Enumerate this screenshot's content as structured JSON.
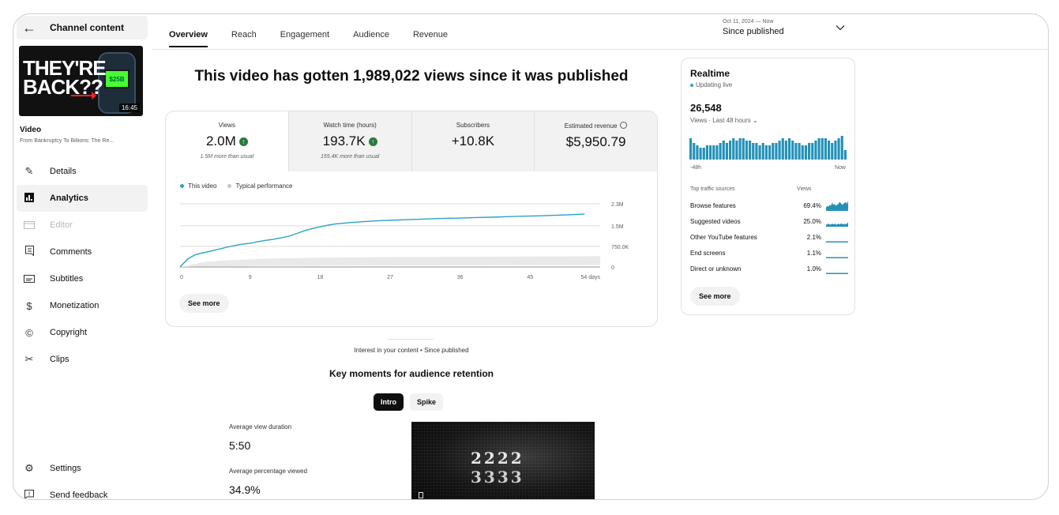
{
  "sidebar": {
    "back_icon": "arrow-left-icon",
    "header": "Channel content",
    "thumbnail": {
      "headline": "THEY'RE BACK??",
      "screen_text": "$25B",
      "duration": "16:45"
    },
    "video_label": "Video",
    "video_title": "From Bankruptcy To Billions: The Re...",
    "items": [
      {
        "label": "Details",
        "icon": "pencil-icon"
      },
      {
        "label": "Analytics",
        "icon": "analytics-icon",
        "active": true
      },
      {
        "label": "Editor",
        "icon": "editor-icon",
        "disabled": true
      },
      {
        "label": "Comments",
        "icon": "comments-icon"
      },
      {
        "label": "Subtitles",
        "icon": "subtitles-icon"
      },
      {
        "label": "Monetization",
        "icon": "dollar-icon"
      },
      {
        "label": "Copyright",
        "icon": "copyright-icon"
      },
      {
        "label": "Clips",
        "icon": "scissors-icon"
      }
    ],
    "bottom": [
      {
        "label": "Settings",
        "icon": "gear-icon"
      },
      {
        "label": "Send feedback",
        "icon": "feedback-icon"
      }
    ]
  },
  "tabs": [
    "Overview",
    "Reach",
    "Engagement",
    "Audience",
    "Revenue"
  ],
  "date_range": {
    "range": "Oct 11, 2024 — Now",
    "label": "Since published"
  },
  "headline": "This video has gotten 1,989,022 views since it was published",
  "metrics": [
    {
      "label": "Views",
      "value": "2.0M",
      "note": "1.5M more than usual",
      "trend_up": true
    },
    {
      "label": "Watch time (hours)",
      "value": "193.7K",
      "note": "155.4K more than usual",
      "trend_up": true
    },
    {
      "label": "Subscribers",
      "value": "+10.8K",
      "note": ""
    },
    {
      "label": "Estimated revenue",
      "value": "$5,950.79",
      "note": ""
    }
  ],
  "chart_data": {
    "type": "line",
    "legend": [
      "This video",
      "Typical performance"
    ],
    "x_ticks": [
      "0",
      "9",
      "18",
      "27",
      "36",
      "45",
      "54 days"
    ],
    "y_ticks": [
      "0",
      "750.0K",
      "1.5M",
      "2.3M"
    ],
    "xlim": [
      0,
      54
    ],
    "ylim": [
      0,
      2300000
    ],
    "colors": {
      "this_video": "#2ba3c4",
      "typical": "#e9e9e9",
      "grid": "#dcdcdc"
    },
    "series": [
      {
        "name": "This video",
        "x": [
          0,
          1,
          2,
          3,
          4,
          5,
          6,
          7,
          8,
          9,
          10,
          11,
          12,
          13,
          14,
          15,
          16,
          17,
          18,
          19,
          20,
          22,
          24,
          26,
          28,
          30,
          32,
          34,
          36,
          38,
          40,
          42,
          44,
          46,
          48,
          50,
          52
        ],
        "y": [
          0,
          300000,
          450000,
          520000,
          580000,
          650000,
          720000,
          780000,
          830000,
          860000,
          920000,
          970000,
          1010000,
          1060000,
          1120000,
          1220000,
          1320000,
          1400000,
          1460000,
          1520000,
          1570000,
          1620000,
          1660000,
          1690000,
          1710000,
          1730000,
          1750000,
          1770000,
          1780000,
          1800000,
          1810000,
          1830000,
          1850000,
          1860000,
          1880000,
          1900000,
          1930000
        ]
      },
      {
        "name": "Typical performance",
        "band_x": [
          0,
          3,
          6,
          9,
          12,
          18,
          27,
          36,
          45,
          54
        ],
        "band_low": [
          0,
          20000,
          30000,
          40000,
          45000,
          50000,
          55000,
          60000,
          65000,
          70000
        ],
        "band_high": [
          0,
          180000,
          240000,
          280000,
          310000,
          340000,
          360000,
          370000,
          380000,
          390000
        ]
      }
    ]
  },
  "see_more": "See more",
  "realtime": {
    "title": "Realtime",
    "status": "Updating live",
    "count": "26,548",
    "count_label": "Views · Last 48 hours",
    "bar_values": [
      9,
      7,
      6,
      5,
      5,
      6,
      6,
      6,
      6,
      7,
      8,
      7,
      8,
      9,
      8,
      9,
      9,
      8,
      8,
      7,
      7,
      6,
      7,
      6,
      6,
      7,
      7,
      8,
      9,
      8,
      9,
      8,
      7,
      7,
      6,
      6,
      7,
      7,
      8,
      9,
      9,
      9,
      8,
      7,
      8,
      9,
      10,
      4
    ],
    "axis_start": "-48h",
    "axis_end": "Now",
    "table_header": [
      "Top traffic sources",
      "Views"
    ],
    "sources": [
      {
        "name": "Browse features",
        "pct": "69.4%",
        "spark": [
          3,
          5,
          4,
          6,
          5,
          8,
          6,
          7,
          5,
          6,
          7,
          9,
          8,
          6,
          7,
          8,
          9,
          7,
          10
        ]
      },
      {
        "name": "Suggested videos",
        "pct": "25.0%",
        "spark": [
          2,
          2,
          3,
          2,
          2,
          3,
          2,
          3,
          2,
          2,
          3,
          2,
          3,
          3,
          2,
          3,
          2,
          3,
          4
        ]
      },
      {
        "name": "Other YouTube features",
        "pct": "2.1%",
        "spark": [
          1,
          1,
          1,
          1,
          1,
          1,
          1,
          1,
          1,
          1,
          1,
          1,
          1,
          1,
          1,
          1,
          1,
          1,
          1
        ]
      },
      {
        "name": "End screens",
        "pct": "1.1%",
        "spark": [
          1,
          1,
          1,
          1,
          1,
          1,
          1,
          1,
          1,
          1,
          1,
          1,
          1,
          1,
          1,
          1,
          1,
          1,
          1
        ]
      },
      {
        "name": "Direct or unknown",
        "pct": "1.0%",
        "spark": [
          1,
          1,
          1,
          1,
          1,
          1,
          1,
          1,
          1,
          1,
          1,
          1,
          1,
          1,
          1,
          1,
          1,
          1,
          1
        ]
      }
    ],
    "see_more": "See more"
  },
  "retention": {
    "interest": "Interest in your content • Since published",
    "title": "Key moments for audience retention",
    "chips": [
      "Intro",
      "Spike"
    ],
    "avg_duration_label": "Average view duration",
    "avg_duration": "5:50",
    "avg_pct_label": "Average percentage viewed",
    "avg_pct": "34.9%",
    "video_text_1": "2222",
    "video_text_2": "3333"
  }
}
